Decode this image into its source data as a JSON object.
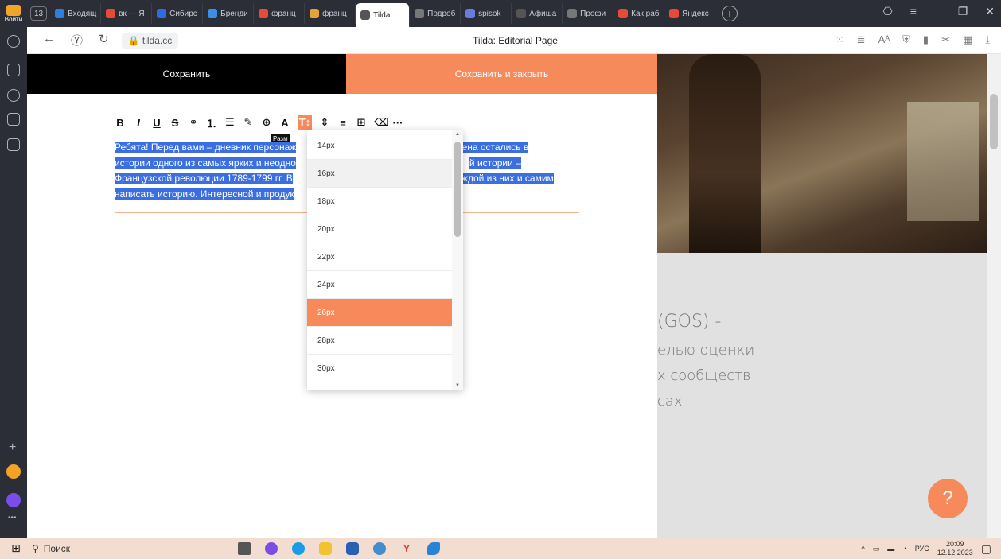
{
  "browser": {
    "login_label": "Войти",
    "tab_count": "13",
    "tabs": [
      {
        "label": "Входящ",
        "color": "#2f7fe0"
      },
      {
        "label": "вк — Я",
        "color": "#e54b3b"
      },
      {
        "label": "Сибирс",
        "color": "#2f6be0"
      },
      {
        "label": "Бренди",
        "color": "#3b8fe6"
      },
      {
        "label": "франц",
        "color": "#e54b3b"
      },
      {
        "label": "франц",
        "color": "#e5a23b"
      },
      {
        "label": "Tilda",
        "color": "#555555",
        "active": true
      },
      {
        "label": "Подроб",
        "color": "#777777"
      },
      {
        "label": "spisok",
        "color": "#6b7ce0"
      },
      {
        "label": "Афиша",
        "color": "#555555"
      },
      {
        "label": "Профи",
        "color": "#777777"
      },
      {
        "label": "Как раб",
        "color": "#e54b3b"
      },
      {
        "label": "Яндекс",
        "color": "#e54b3b"
      }
    ],
    "url": "tilda.cc",
    "page_title": "Tilda: Editorial Page"
  },
  "editor": {
    "save_label": "Сохранить",
    "save_close_label": "Сохранить и закрыть",
    "tooltip": "Разм",
    "text_lines": [
      "Ребята! Перед вами – дневник персонаж",
      "истории одного из самых ярких и неодно",
      "Французской революции 1789-1799 гг. В",
      "написать историю. Интересной и продук"
    ],
    "text_lines_right": [
      "мена остались в",
      "й истории –",
      "каждой из них и самим",
      ""
    ],
    "toolbar": [
      "B",
      "I",
      "U",
      "S",
      "link",
      "ol",
      "ul",
      "pen",
      "globe",
      "A",
      "TT",
      "lh",
      "align",
      "book",
      "erase",
      "more"
    ]
  },
  "font_size_dropdown": {
    "options": [
      "14px",
      "16px",
      "18px",
      "20px",
      "22px",
      "24px",
      "26px",
      "28px",
      "30px"
    ],
    "hovered": "16px",
    "selected": "26px"
  },
  "preview": {
    "lines": [
      "(GOS) -",
      "елью оценки",
      "х сообществ",
      "сах"
    ],
    "help_label": "?"
  },
  "taskbar": {
    "search_label": "Поиск",
    "lang": "РУС",
    "time": "20:09",
    "date": "12.12.2023"
  }
}
